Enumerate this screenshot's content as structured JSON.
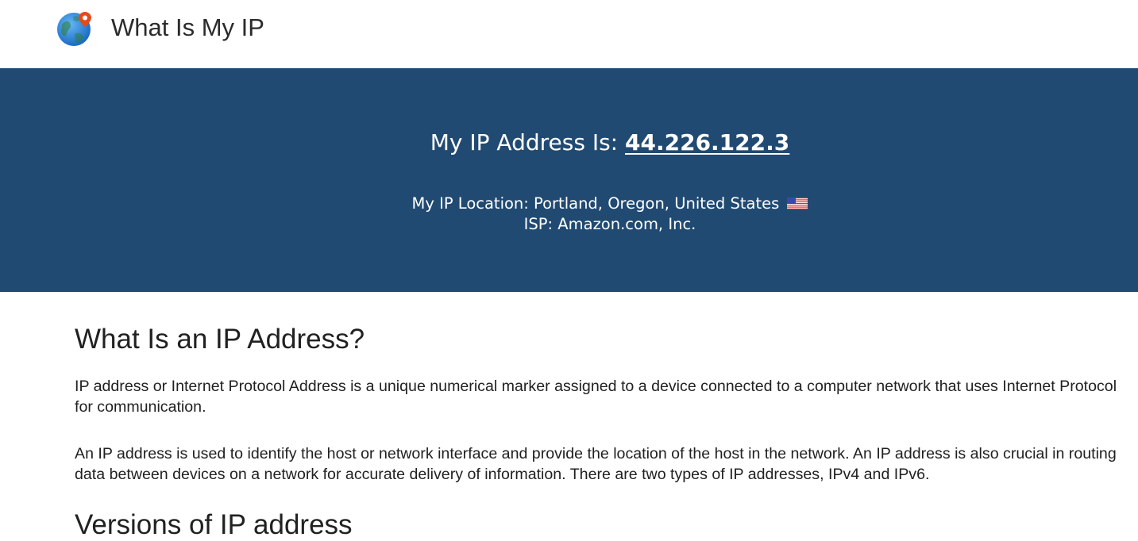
{
  "header": {
    "logo_icon": "globe-location-pin-icon",
    "brand": "What Is My IP"
  },
  "hero": {
    "ip_prefix": "My IP Address Is: ",
    "ip_address": "44.226.122.3",
    "location_text": "My IP Location: Portland, Oregon, United States",
    "flag_icon": "us-flag-icon",
    "isp_text": "ISP: Amazon.com, Inc."
  },
  "article": {
    "heading": "What Is an IP Address?",
    "paragraph_1": "IP address or Internet Protocol Address is a unique numerical marker assigned to a device connected to a computer network that uses Internet Protocol for communication.",
    "paragraph_2": "An IP address is used to identify the host or network interface and provide the location of the host in the network. An IP address is also crucial in routing data between devices on a network for accurate delivery of information. There are two types of IP addresses, IPv4 and IPv6.",
    "subheading": "Versions of IP address"
  },
  "colors": {
    "hero_background": "#214a72",
    "text": "#212121",
    "globe_blue": "#1e88e5",
    "pin_red": "#e64a19"
  }
}
